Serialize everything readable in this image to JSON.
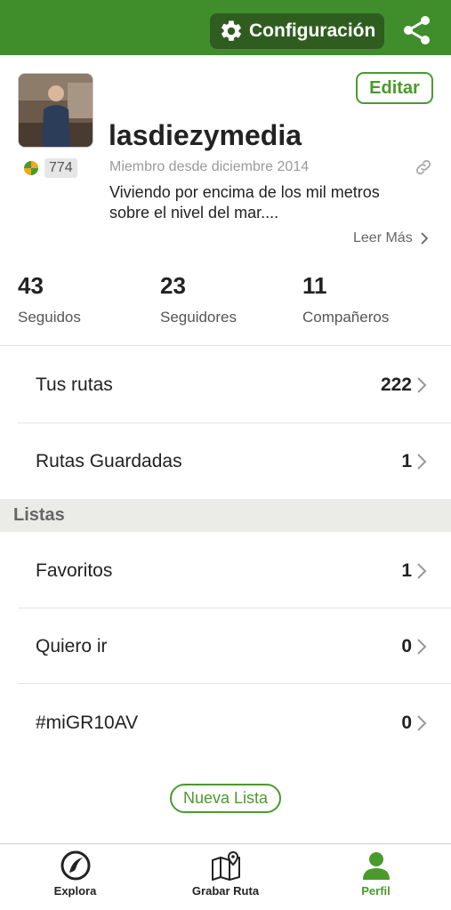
{
  "topbar": {
    "config_label": "Configuración"
  },
  "profile": {
    "username": "lasdiezymedia",
    "member_since": "Miembro desde diciembre 2014",
    "bio": "Viviendo por encima de los mil metros sobre el nivel del mar....",
    "read_more": "Leer Más",
    "badge_count": "774",
    "edit_label": "Editar"
  },
  "stats": [
    {
      "value": "43",
      "label": "Seguidos"
    },
    {
      "value": "23",
      "label": "Seguidores"
    },
    {
      "value": "11",
      "label": "Compañeros"
    }
  ],
  "routes": [
    {
      "label": "Tus rutas",
      "count": "222"
    },
    {
      "label": "Rutas Guardadas",
      "count": "1"
    }
  ],
  "lists": {
    "header": "Listas",
    "items": [
      {
        "label": "Favoritos",
        "count": "1"
      },
      {
        "label": "Quiero ir",
        "count": "0"
      },
      {
        "label": "#miGR10AV",
        "count": "0"
      }
    ],
    "new_list_label": "Nueva Lista"
  },
  "tabbar": {
    "tabs": [
      {
        "label": "Explora",
        "icon": "compass-icon",
        "active": false
      },
      {
        "label": "Grabar Ruta",
        "icon": "map-pin-icon",
        "active": false
      },
      {
        "label": "Perfil",
        "icon": "user-icon",
        "active": true
      }
    ]
  },
  "colors": {
    "brand_green": "#3f8e2b",
    "dark_green": "#2f5d20",
    "accent_green": "#4a9a2d"
  }
}
